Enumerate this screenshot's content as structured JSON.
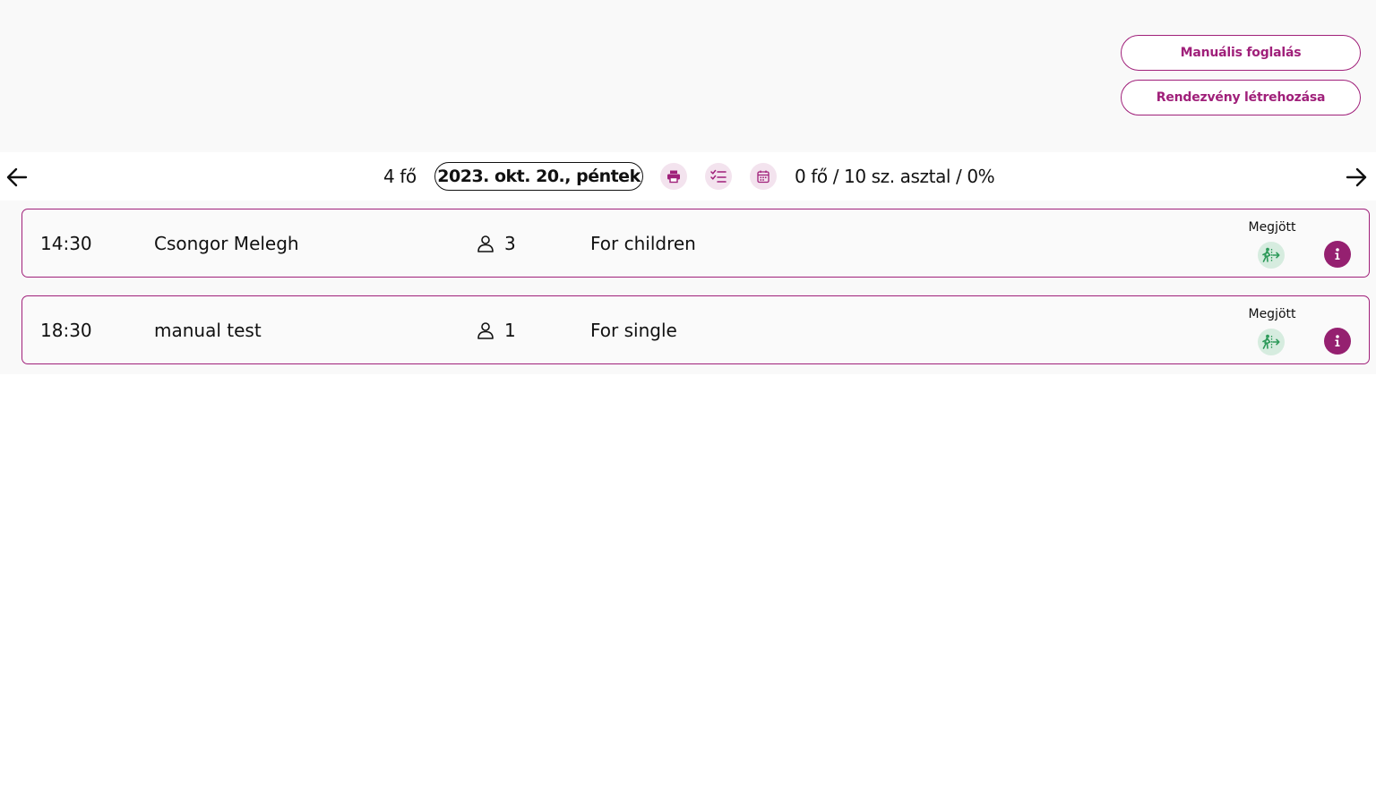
{
  "header": {
    "manual_booking_label": "Manuális foglalás",
    "create_event_label": "Rendezvény létrehozása"
  },
  "nav": {
    "total_guests": "4 fő",
    "date": "2023. okt. 20., péntek",
    "capacity": "0 fő / 10 sz. asztal / 0%"
  },
  "colors": {
    "accent": "#a0207a",
    "info_button": "#952070",
    "arrived_icon": "#2e9a5a",
    "panel_bg": "#f9f9f9"
  },
  "reservations": [
    {
      "time": "14:30",
      "name": "Csongor Melegh",
      "guests": "3",
      "note": "For children",
      "status_label": "Megjött"
    },
    {
      "time": "18:30",
      "name": "manual test",
      "guests": "1",
      "note": "For single",
      "status_label": "Megjött"
    }
  ],
  "icons": [
    "arrow-left-icon",
    "arrow-right-icon",
    "print-icon",
    "checklist-icon",
    "calendar-icon",
    "person-icon",
    "person-arrived-icon",
    "info-icon"
  ]
}
